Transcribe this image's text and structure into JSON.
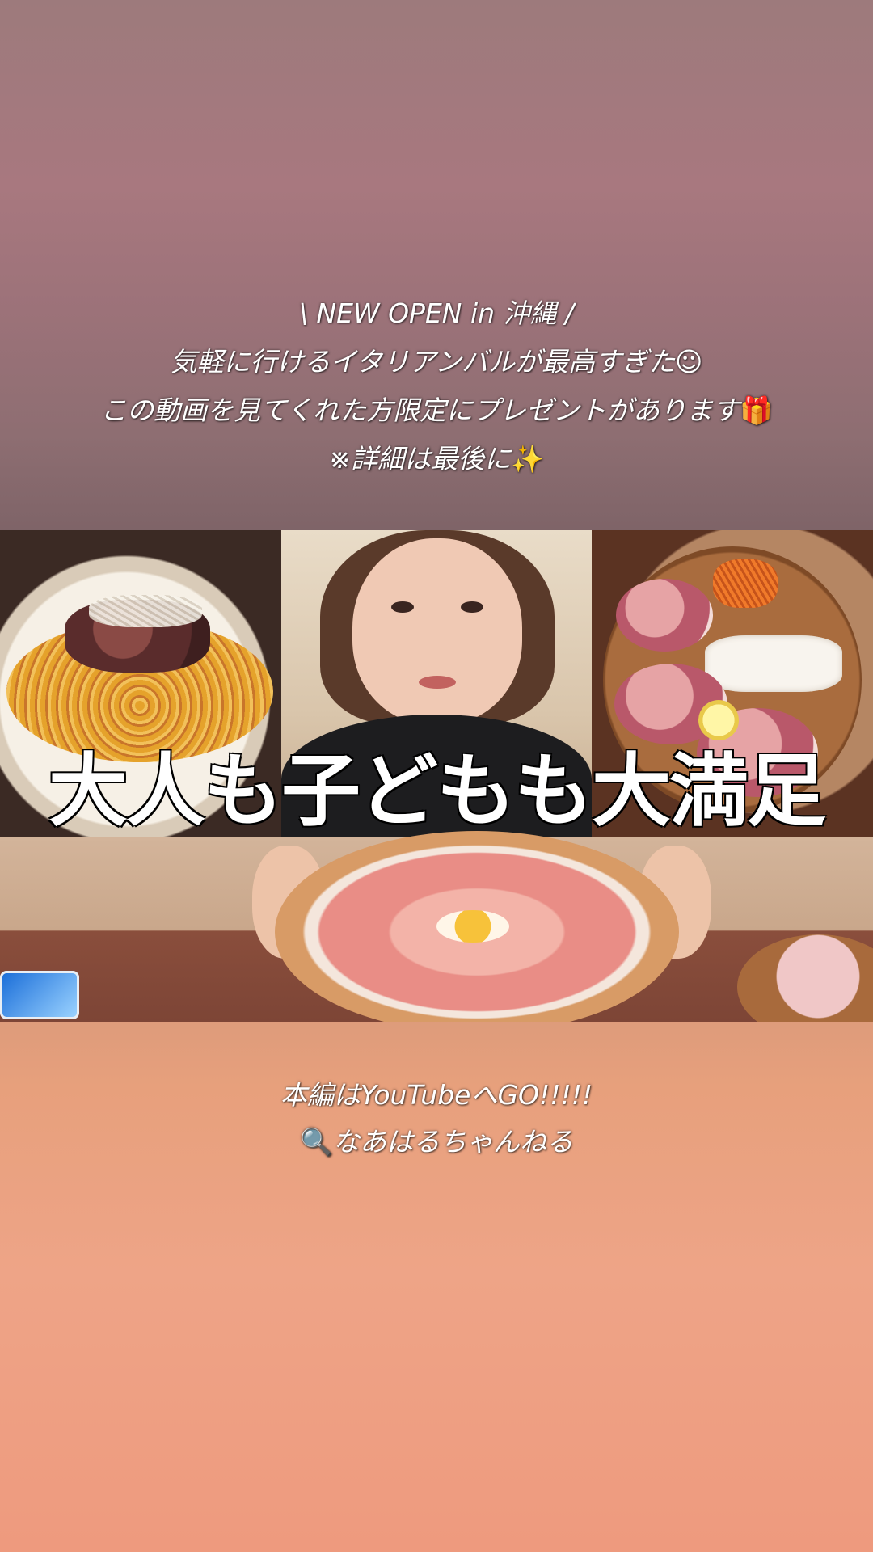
{
  "caption_top": {
    "line1": "\\ NEW OPEN in 沖縄 /",
    "line2": "気軽に行けるイタリアンバルが最高すぎた",
    "line2_emoji": "☺",
    "line3": "この動画を見てくれた方限定にプレゼントがあります",
    "line3_emoji": "🎁",
    "line4": "※詳細は最後に",
    "line4_emoji": "✨"
  },
  "video": {
    "headline": "大人も子どもも大満足",
    "panels": [
      "pasta-photo",
      "person-photo",
      "antipasto-photo"
    ]
  },
  "caption_bottom": {
    "line1": "本編はYouTubeへGO!!!!!",
    "line2_icon": "🔍",
    "line2": "なあはるちゃんねる"
  }
}
